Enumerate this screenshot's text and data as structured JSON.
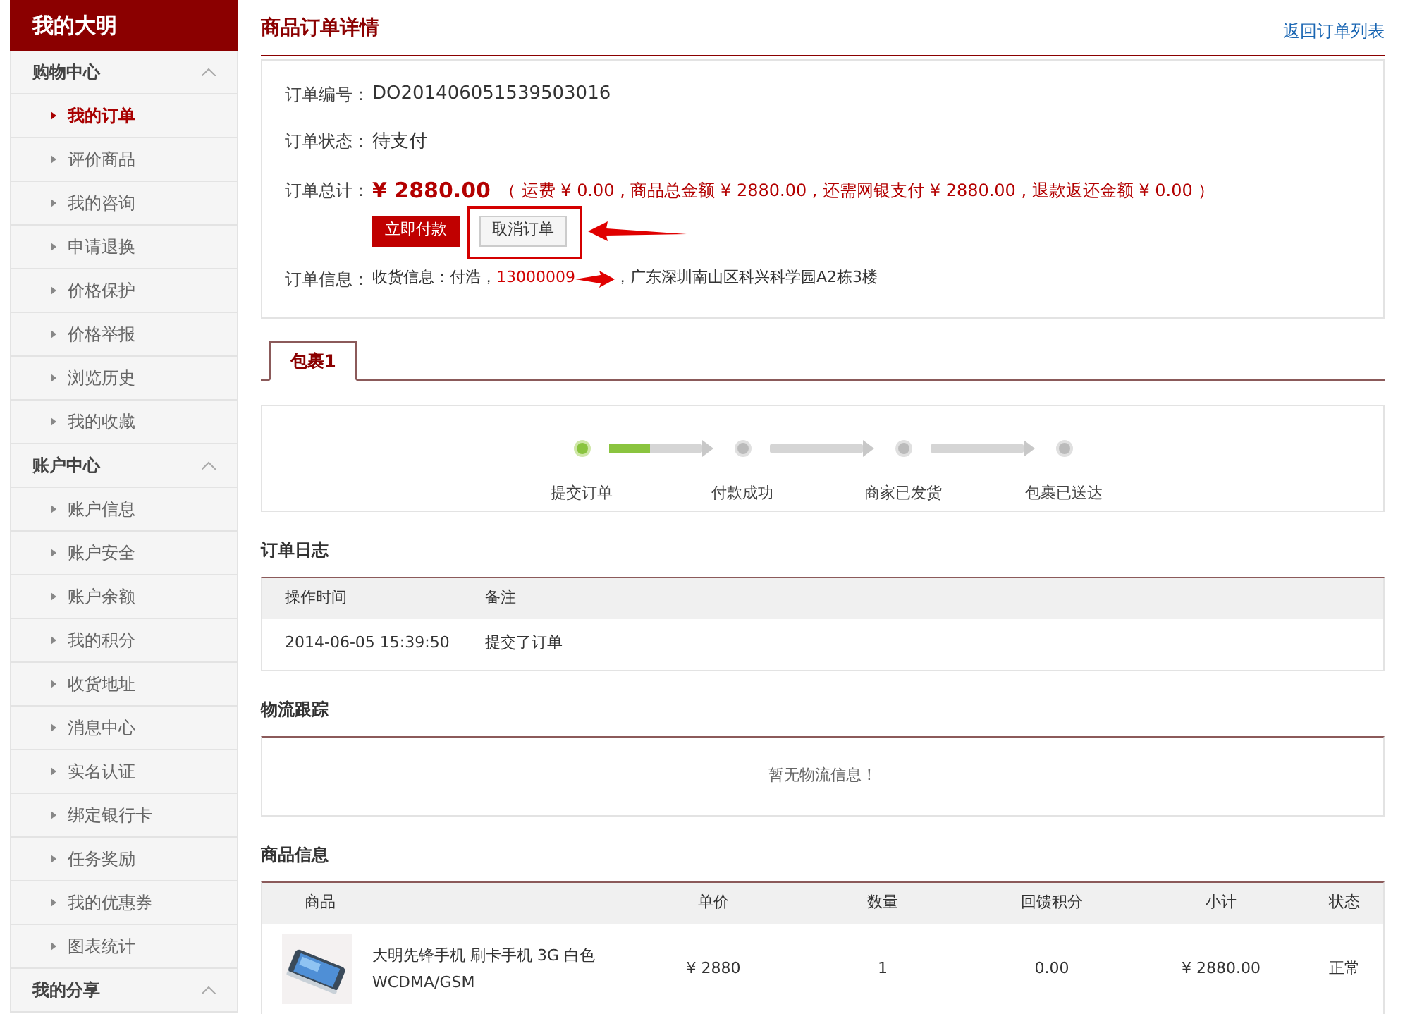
{
  "sidebar": {
    "title": "我的大明",
    "groups": [
      {
        "label": "购物中心",
        "expanded": true,
        "items": [
          {
            "label": "我的订单",
            "selected": true
          },
          {
            "label": "评价商品",
            "selected": false
          },
          {
            "label": "我的咨询",
            "selected": false
          },
          {
            "label": "申请退换",
            "selected": false
          },
          {
            "label": "价格保护",
            "selected": false
          },
          {
            "label": "价格举报",
            "selected": false
          },
          {
            "label": "浏览历史",
            "selected": false
          },
          {
            "label": "我的收藏",
            "selected": false
          }
        ]
      },
      {
        "label": "账户中心",
        "expanded": true,
        "items": [
          {
            "label": "账户信息",
            "selected": false
          },
          {
            "label": "账户安全",
            "selected": false
          },
          {
            "label": "账户余额",
            "selected": false
          },
          {
            "label": "我的积分",
            "selected": false
          },
          {
            "label": "收货地址",
            "selected": false
          },
          {
            "label": "消息中心",
            "selected": false
          },
          {
            "label": "实名认证",
            "selected": false
          },
          {
            "label": "绑定银行卡",
            "selected": false
          },
          {
            "label": "任务奖励",
            "selected": false
          },
          {
            "label": "我的优惠券",
            "selected": false
          },
          {
            "label": "图表统计",
            "selected": false
          }
        ]
      },
      {
        "label": "我的分享",
        "expanded": true
      }
    ]
  },
  "page": {
    "title": "商品订单详情",
    "back_link": "返回订单列表"
  },
  "order": {
    "number_label": "订单编号：",
    "number": "DO201406051539503016",
    "status_label": "订单状态：",
    "status": "待支付",
    "total_label": "订单总计：",
    "total": "¥ 2880.00",
    "total_detail": "（ 运费 ¥ 0.00 , 商品总金额 ¥ 2880.00 , 还需网银支付 ¥ 2880.00 , 退款返还金额 ¥ 0.00 ）",
    "buttons": [
      {
        "label": "立即付款",
        "kind": "primary"
      },
      {
        "label": "取消订单",
        "kind": "secondary"
      }
    ],
    "info_label": "订单信息：",
    "info_prefix": "收货信息：付浩，",
    "phone": "13000009",
    "info_suffix": "，广东深圳南山区科兴科学园A2栋3楼"
  },
  "tabs": [
    {
      "label": "包裹1",
      "selected": true
    }
  ],
  "progress": {
    "steps": [
      {
        "label": "提交订单",
        "done": true,
        "level": 0.45
      },
      {
        "label": "付款成功",
        "done": false
      },
      {
        "label": "商家已发货",
        "done": false
      },
      {
        "label": "包裹已送达",
        "done": false
      }
    ]
  },
  "log": {
    "title": "订单日志",
    "columns": [
      "操作时间",
      "备注"
    ],
    "rows": [
      [
        "2014-06-05 15:39:50",
        "提交了订单"
      ]
    ]
  },
  "logistics": {
    "title": "物流跟踪",
    "empty": "暂无物流信息！"
  },
  "products": {
    "title": "商品信息",
    "columns": [
      "商品",
      "单价",
      "数量",
      "回馈积分",
      "小计",
      "状态"
    ],
    "rows": [
      {
        "name": "大明先锋手机 刷卡手机 3G 白色 WCDMA/GSM",
        "price": "¥ 2880",
        "qty": "1",
        "points": "0.00",
        "subtotal": "¥ 2880.00",
        "status": "正常"
      }
    ]
  }
}
